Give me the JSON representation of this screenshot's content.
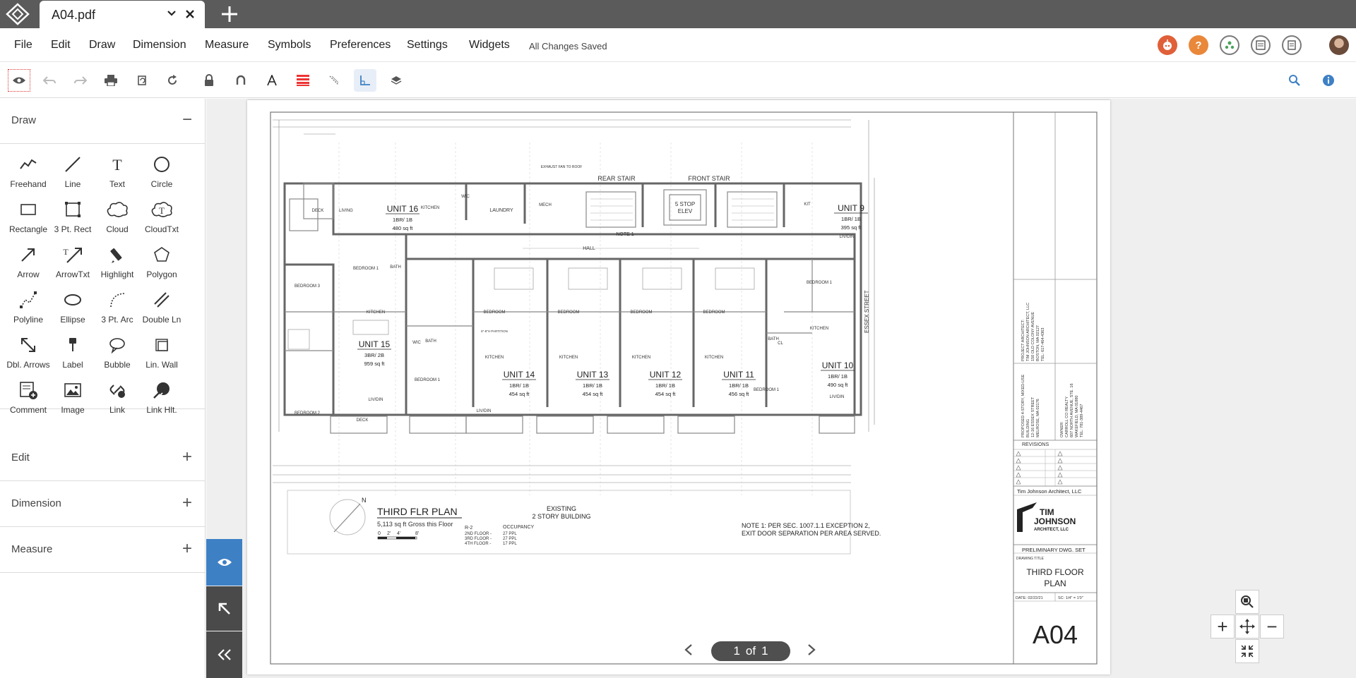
{
  "tab": {
    "file_name": "A04.pdf"
  },
  "menu": {
    "items": [
      "File",
      "Edit",
      "Draw",
      "Dimension",
      "Measure",
      "Symbols",
      "Preferences",
      "Settings",
      "Widgets"
    ],
    "status": "All Changes Saved",
    "help_label": "?"
  },
  "left_panel": {
    "draw_title": "Draw",
    "draw_toggle": "−",
    "tools": [
      "Freehand",
      "Line",
      "Text",
      "Circle",
      "Rectangle",
      "3 Pt. Rect",
      "Cloud",
      "CloudTxt",
      "Arrow",
      "ArrowTxt",
      "Highlight",
      "Polygon",
      "Polyline",
      "Ellipse",
      "3 Pt. Arc",
      "Double Ln",
      "Dbl. Arrows",
      "Label",
      "Bubble",
      "Lin. Wall",
      "Comment",
      "Image",
      "Link",
      "Link Hlt."
    ],
    "sections": [
      {
        "title": "Edit",
        "toggle": "+"
      },
      {
        "title": "Dimension",
        "toggle": "+"
      },
      {
        "title": "Measure",
        "toggle": "+"
      }
    ]
  },
  "drawing": {
    "units": [
      {
        "name": "UNIT 16",
        "type": "1BR/ 1B",
        "area": "480 sq ft"
      },
      {
        "name": "UNIT 9",
        "type": "1BR/ 1B",
        "area": "395 sq ft"
      },
      {
        "name": "UNIT 15",
        "type": "3BR/ 2B",
        "area": "959 sq ft"
      },
      {
        "name": "UNIT 14",
        "type": "1BR/ 1B",
        "area": "454 sq ft"
      },
      {
        "name": "UNIT 13",
        "type": "1BR/ 1B",
        "area": "454 sq ft"
      },
      {
        "name": "UNIT 12",
        "type": "1BR/ 1B",
        "area": "454 sq ft"
      },
      {
        "name": "UNIT 11",
        "type": "1BR/ 1B",
        "area": "456 sq ft"
      },
      {
        "name": "UNIT 10",
        "type": "1BR/ 1B",
        "area": "490 sq ft"
      }
    ],
    "labels": {
      "rear_stair": "REAR STAIR",
      "front_stair": "FRONT STAIR",
      "elev_1": "5 STOP",
      "elev_2": "ELEV",
      "hall": "HALL",
      "note_1": "NOTE 1",
      "laundry": "LAUNDRY",
      "mech": "MECH",
      "living": "LIVING",
      "deck": "DECK",
      "kitchen": "KITCHEN",
      "bath": "BATH",
      "wic": "WIC",
      "bedroom": "BEDROOM",
      "bedroom_1": "BEDROOM 1",
      "bedroom_2": "BEDROOM 2",
      "bedroom_3": "BEDROOM 3",
      "liv_din": "LIV/DIN",
      "kit": "KIT",
      "cl": "CL",
      "partition": "6\"-8\"H PARTITION",
      "street": "ESSEX STREET",
      "exhaust": "EXHAUST FAN TO ROOF"
    },
    "plan_title": "THIRD FLR PLAN",
    "plan_subtitle": "5,113 sq ft Gross this Floor",
    "scale_labels": [
      "0",
      "2'",
      "4'",
      "8'"
    ],
    "existing_1": "EXISTING",
    "existing_2": "2 STORY BUILDING",
    "occupancy": {
      "code": "R-2",
      "title": "OCCUPANCY",
      "floors": [
        "2ND FLOOR -",
        "3RD FLOOR -",
        "4TH FLOOR -"
      ],
      "counts": [
        "27 PPL",
        "27 PPL",
        "17 PPL"
      ]
    },
    "note_line_1": "NOTE 1: PER SEC. 1007.1.1 EXCEPTION 2,",
    "note_line_2": "EXIT DOOR SEPARATION PER AREA SERVED.",
    "title_block": {
      "architect_lines": [
        "PROJECT ARCHITECT:",
        "TIM JOHNSON ARCHITECT, LLC",
        "150 OLD COLONY AVENUE",
        "BOSTON, MA 02127",
        "TEL: 617-464-4363"
      ],
      "project_lines": [
        "PROPOSED 4-STORY, MIXED-USE",
        "BUILDING",
        "12-16 ESSEX STREET",
        "MELROSE, MA 02176"
      ],
      "owner_lines": [
        "OWNER:",
        "CARROLL CO REALTY",
        "607 NORTH AVENUE, STE. 16",
        "WAKEFIELD, MA 01880",
        "TEL: 781-389-4467"
      ],
      "revisions": "REVISIONS",
      "firm": "Tim Johnson Architect, LLC",
      "logo_line_1": "TIM",
      "logo_line_2": "JOHNSON",
      "logo_line_3": "ARCHITECT, LLC",
      "set": "PRELIMINARY DWG. SET",
      "drawing_title_label": "DRAWING TITLE",
      "drawing_title_1": "THIRD FLOOR",
      "drawing_title_2": "PLAN",
      "date": "DATE: 02/22/21",
      "scale": "SC: 1/4\" = 1'0\"",
      "sheet": "A04"
    }
  },
  "pager": {
    "current": "1",
    "of": "of",
    "total": "1"
  },
  "zoom": {
    "plus": "+",
    "minus": "−"
  },
  "colors": {
    "tabbar": "#5b5b5b",
    "accent": "#3e80c4",
    "sidetab": "#4a4a4a",
    "help_orange": "#e9883a",
    "bot_red": "#e0603a",
    "plus_green": "#4aa35a"
  }
}
